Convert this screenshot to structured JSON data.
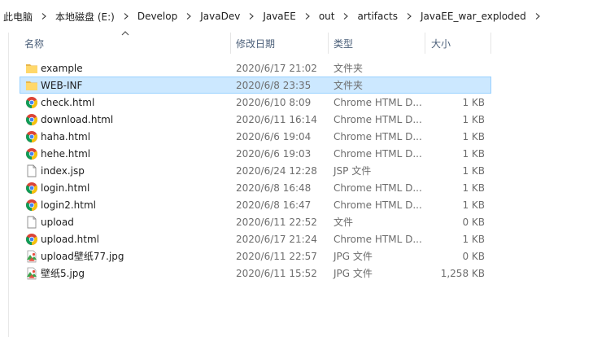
{
  "breadcrumb": [
    "此电脑",
    "本地磁盘 (E:)",
    "Develop",
    "JavaDev",
    "JavaEE",
    "out",
    "artifacts",
    "JavaEE_war_exploded"
  ],
  "columns": {
    "name": "名称",
    "date": "修改日期",
    "type": "类型",
    "size": "大小"
  },
  "files": [
    {
      "name": "example",
      "date": "2020/6/17 21:02",
      "type": "文件夹",
      "size": "",
      "icon": "folder-icon"
    },
    {
      "name": "WEB-INF",
      "date": "2020/6/8 23:35",
      "type": "文件夹",
      "size": "",
      "icon": "folder-icon",
      "selected": true
    },
    {
      "name": "check.html",
      "date": "2020/6/10 8:09",
      "type": "Chrome HTML D...",
      "size": "1 KB",
      "icon": "chrome-html-icon"
    },
    {
      "name": "download.html",
      "date": "2020/6/11 16:14",
      "type": "Chrome HTML D...",
      "size": "1 KB",
      "icon": "chrome-html-icon"
    },
    {
      "name": "haha.html",
      "date": "2020/6/6 19:04",
      "type": "Chrome HTML D...",
      "size": "1 KB",
      "icon": "chrome-html-icon"
    },
    {
      "name": "hehe.html",
      "date": "2020/6/6 19:03",
      "type": "Chrome HTML D...",
      "size": "1 KB",
      "icon": "chrome-html-icon"
    },
    {
      "name": "index.jsp",
      "date": "2020/6/24 12:28",
      "type": "JSP 文件",
      "size": "1 KB",
      "icon": "blank-file-icon"
    },
    {
      "name": "login.html",
      "date": "2020/6/8 16:48",
      "type": "Chrome HTML D...",
      "size": "1 KB",
      "icon": "chrome-html-icon"
    },
    {
      "name": "login2.html",
      "date": "2020/6/8 16:47",
      "type": "Chrome HTML D...",
      "size": "1 KB",
      "icon": "chrome-html-icon"
    },
    {
      "name": "upload",
      "date": "2020/6/11 22:52",
      "type": "文件",
      "size": "0 KB",
      "icon": "blank-file-icon"
    },
    {
      "name": "upload.html",
      "date": "2020/6/17 21:24",
      "type": "Chrome HTML D...",
      "size": "1 KB",
      "icon": "chrome-html-icon"
    },
    {
      "name": "upload壁纸77.jpg",
      "date": "2020/6/11 22:57",
      "type": "JPG 文件",
      "size": "0 KB",
      "icon": "jpg-file-icon"
    },
    {
      "name": "壁纸5.jpg",
      "date": "2020/6/11 15:52",
      "type": "JPG 文件",
      "size": "1,258 KB",
      "icon": "jpg-file-icon"
    }
  ],
  "colors": {
    "selection_bg": "#cce8ff",
    "selection_border": "#99d1ff",
    "header_text": "#4c607a",
    "folder": "#ffd86b"
  }
}
